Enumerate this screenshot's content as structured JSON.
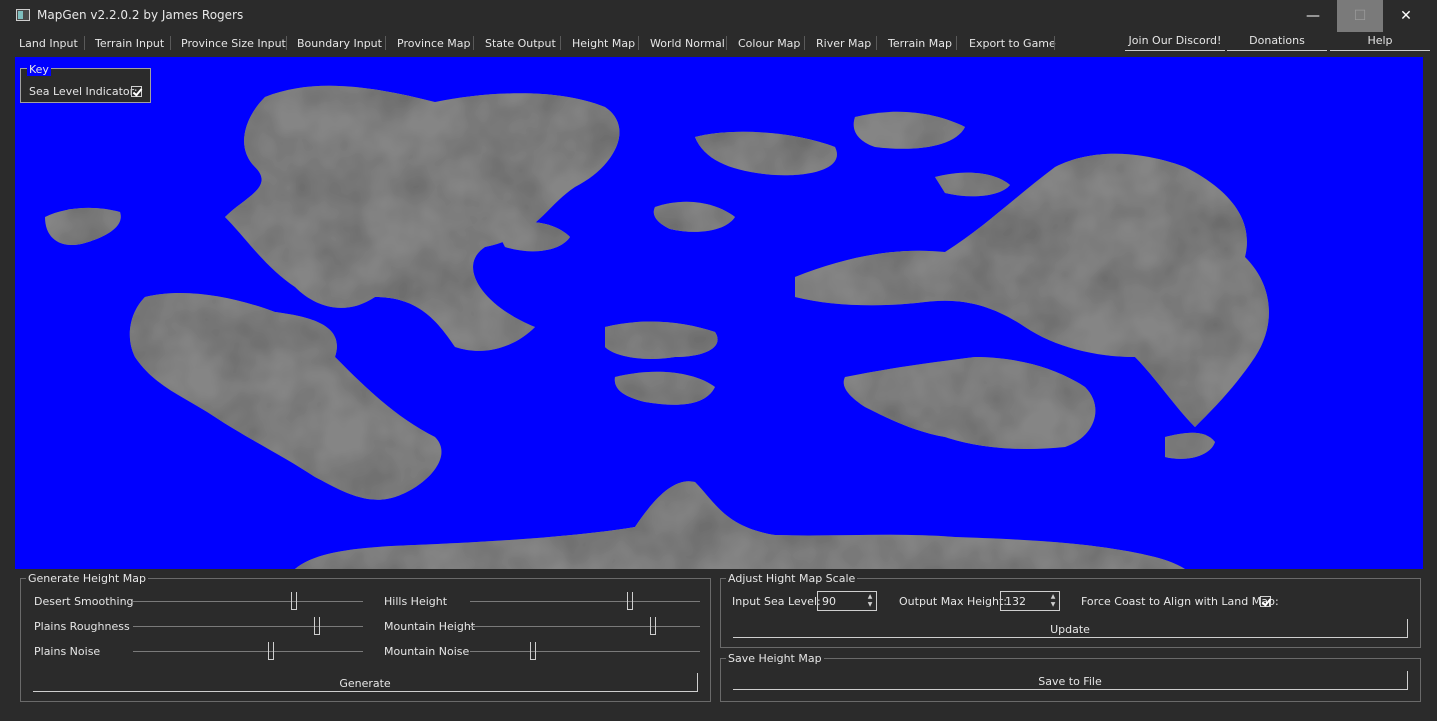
{
  "window": {
    "title": "MapGen v2.2.0.2 by James Rogers",
    "minimize_glyph": "—",
    "maximize_glyph": "☐",
    "close_glyph": "✕"
  },
  "menu": {
    "tabs": [
      {
        "label": "Land Input"
      },
      {
        "label": "Terrain Input"
      },
      {
        "label": "Province Size Input"
      },
      {
        "label": "Boundary Input"
      },
      {
        "label": "Province Map"
      },
      {
        "label": "State Output"
      },
      {
        "label": "Height Map"
      },
      {
        "label": "World Normal"
      },
      {
        "label": "Colour Map"
      },
      {
        "label": "River Map"
      },
      {
        "label": "Terrain Map"
      },
      {
        "label": "Export to Game"
      }
    ],
    "right_buttons": [
      {
        "label": "Join Our Discord!"
      },
      {
        "label": "Donations"
      },
      {
        "label": "Help"
      }
    ]
  },
  "map": {
    "sea_color": "#0000ff",
    "land_color": "#808080",
    "key": {
      "title": "Key",
      "sea_level_label": "Sea Level Indicator:",
      "sea_level_checked": true
    }
  },
  "generate_panel": {
    "title": "Generate Height Map",
    "sliders": [
      {
        "label": "Desert Smoothing",
        "value": 0.7
      },
      {
        "label": "Hills Height",
        "value": 0.7
      },
      {
        "label": "Plains Roughness",
        "value": 0.8
      },
      {
        "label": "Mountain Height",
        "value": 0.8
      },
      {
        "label": "Plains Noise",
        "value": 0.6
      },
      {
        "label": "Mountain Noise",
        "value": 0.27
      }
    ],
    "generate_label": "Generate"
  },
  "adjust_panel": {
    "title": "Adjust Hight Map Scale",
    "sea_level_label": "Input Sea Level:",
    "sea_level_value": "90",
    "max_height_label": "Output Max Height:",
    "max_height_value": "132",
    "force_coast_label": "Force Coast to Align with Land Map:",
    "force_coast_checked": true,
    "update_label": "Update"
  },
  "save_panel": {
    "title": "Save Height Map",
    "save_label": "Save to File"
  }
}
